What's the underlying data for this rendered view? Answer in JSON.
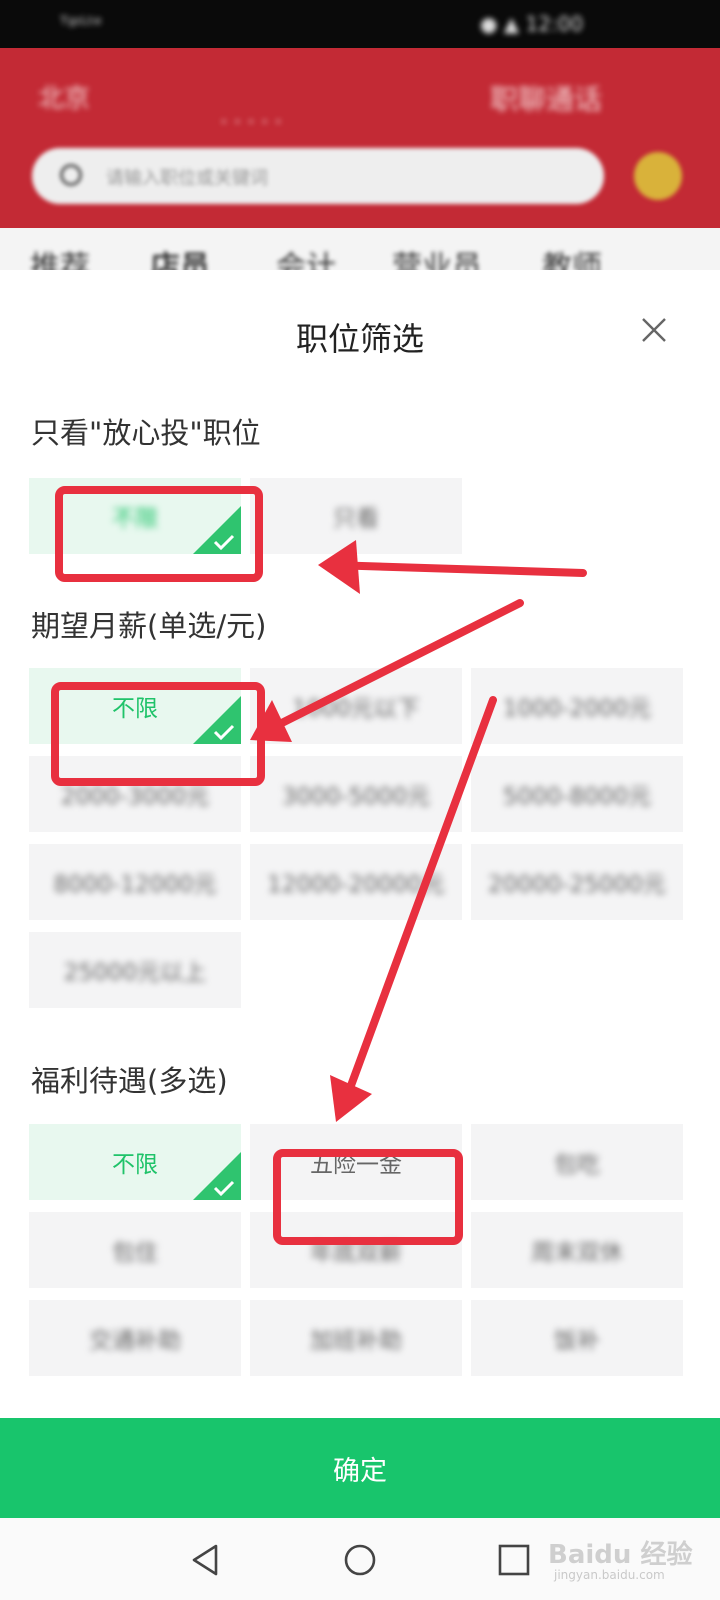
{
  "background": {
    "status_left": "ᵀᵍᶦᴸᵗᵉ",
    "status_right": "● ▲ 12:00",
    "location": "北京",
    "header_center": "·····",
    "header_right": "职聊通话",
    "search_placeholder": "请输入职位或关键词",
    "tabs": [
      "推荐",
      "店员",
      "会计",
      "营业员",
      "教师"
    ]
  },
  "sheet": {
    "title": "职位筛选",
    "close_icon": "close-icon"
  },
  "sections": {
    "fangxintou": {
      "title": "只看\"放心投\"职位",
      "options": [
        "不限",
        "只看"
      ],
      "selected": "不限"
    },
    "salary": {
      "title": "期望月薪(单选/元)",
      "options": [
        "不限",
        "1000元以下",
        "1000-2000元",
        "2000-3000元",
        "3000-5000元",
        "5000-8000元",
        "8000-12000元",
        "12000-20000元",
        "20000-25000元",
        "25000元以上"
      ],
      "selected": "不限"
    },
    "welfare": {
      "title": "福利待遇(多选)",
      "options": [
        "不限",
        "五险一金",
        "包吃",
        "包住",
        "年底双薪",
        "周末双休",
        "交通补助",
        "加班补助",
        "饭补"
      ],
      "selected": "不限"
    }
  },
  "confirm_label": "确定",
  "watermark": {
    "main": "Baidu 经验",
    "sub": "jingyan.baidu.com"
  },
  "colors": {
    "accent_green": "#18c56c",
    "selected_text": "#20c36a",
    "selected_bg": "#e8f8ef",
    "annotation_red": "#e8303f",
    "header_red": "#c32a35"
  }
}
